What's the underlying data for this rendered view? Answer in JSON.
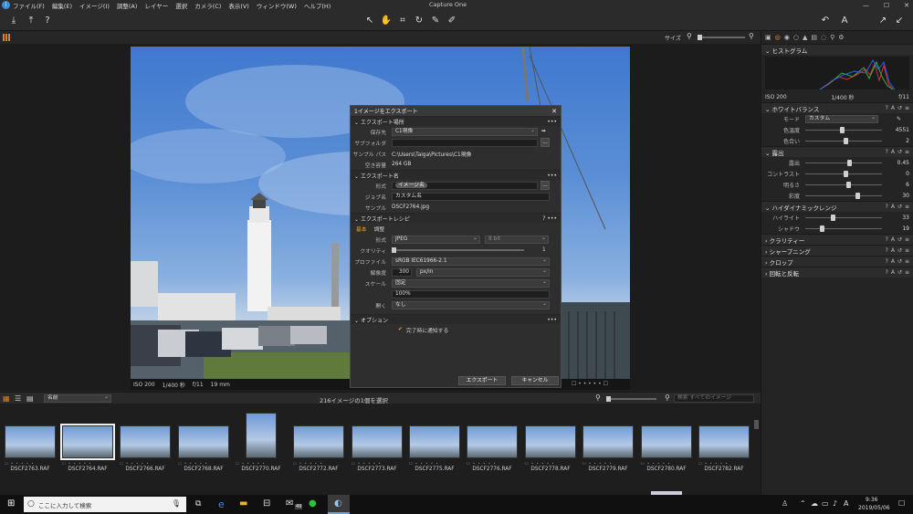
{
  "app": {
    "title": "Capture One",
    "menu": [
      "ファイル(F)",
      "編集(E)",
      "イメージ(I)",
      "調整(A)",
      "レイヤー",
      "選択",
      "カメラ(C)",
      "表示(V)",
      "ウィンドウ(W)",
      "ヘルプ(H)"
    ]
  },
  "viewer": {
    "size_label": "サイズ",
    "caption": [
      "ISO 200",
      "1/400 秒",
      "f/11",
      "19 mm"
    ]
  },
  "dialog": {
    "title": "1イメージをエクスポート",
    "location": {
      "header": "エクスポート場所",
      "dest_label": "保存先",
      "dest_value": "C1現像",
      "subfolder_label": "サブフォルダ",
      "sample_path_label": "サンプル パス",
      "sample_path": "C:\\Users\\Taiga\\Pictures\\C1現像",
      "free_label": "空き容量",
      "free_value": "264 GB"
    },
    "naming": {
      "header": "エクスポート名",
      "format_label": "形式",
      "format_token": "イメージ名",
      "job_label": "ジョブ名",
      "job_value": "カスタム名",
      "sample_label": "サンプル",
      "sample_value": "DSCF2764.jpg"
    },
    "recipe": {
      "header": "エクスポートレシピ",
      "tab_basic": "基本",
      "tab_adjust": "調整",
      "format_label": "形式",
      "format_value": "JPEG",
      "bit_value": "8 bit",
      "quality_label": "クオリティ",
      "quality_value": "1",
      "profile_label": "プロファイル",
      "profile_value": "sRGB IEC61966-2.1",
      "resolution_label": "解像度",
      "resolution_value": "300",
      "resolution_unit": "px/in",
      "scale_label": "スケール",
      "scale_value": "固定",
      "scale_percent": "100%",
      "open_label": "開く",
      "open_value": "なし"
    },
    "options": {
      "header": "オプション",
      "notify_label": "完了時に通知する"
    },
    "export_button": "エクスポート",
    "cancel_button": "キャンセル"
  },
  "right_panel": {
    "histogram": {
      "title": "ヒストグラム",
      "iso": "ISO 200",
      "shutter": "1/400 秒",
      "aperture": "f/11"
    },
    "white_balance": {
      "title": "ホワイトバランス",
      "mode_label": "モード",
      "mode_value": "カスタム",
      "temp_label": "色温度",
      "temp_value": "4551",
      "tint_label": "色合い",
      "tint_value": "2"
    },
    "exposure": {
      "title": "露出",
      "rows": [
        {
          "label": "露出",
          "value": "0.45",
          "level": 0.55
        },
        {
          "label": "コントラスト",
          "value": "0",
          "level": 0.5
        },
        {
          "label": "明るさ",
          "value": "6",
          "level": 0.53
        },
        {
          "label": "彩度",
          "value": "30",
          "level": 0.65
        }
      ]
    },
    "hdr": {
      "title": "ハイダイナミックレンジ",
      "rows": [
        {
          "label": "ハイライト",
          "value": "33",
          "level": 0.33
        },
        {
          "label": "シャドウ",
          "value": "19",
          "level": 0.19
        }
      ]
    },
    "collapsed": [
      "クラリティー",
      "シャープニング",
      "クロップ",
      "回転と反転"
    ]
  },
  "browser": {
    "sort_label": "名前",
    "selection_text": "216イメージの1個を選択",
    "search_placeholder": "検索 すべてのイメージ",
    "thumbnails": [
      {
        "name": "DSCF2763.RAF"
      },
      {
        "name": "DSCF2764.RAF",
        "selected": true
      },
      {
        "name": "DSCF2766.RAF"
      },
      {
        "name": "DSCF2768.RAF"
      },
      {
        "name": "DSCF2770.RAF"
      },
      {
        "name": "DSCF2772.RAF"
      },
      {
        "name": "DSCF2773.RAF"
      },
      {
        "name": "DSCF2775.RAF"
      },
      {
        "name": "DSCF2776.RAF"
      },
      {
        "name": "DSCF2778.RAF"
      },
      {
        "name": "DSCF2779.RAF"
      },
      {
        "name": "DSCF2780.RAF"
      },
      {
        "name": "DSCF2782.RAF"
      }
    ]
  },
  "taskbar": {
    "search_placeholder": "ここに入力して検索",
    "time": "9:36",
    "date": "2019/05/06",
    "mail_badge": "49"
  }
}
